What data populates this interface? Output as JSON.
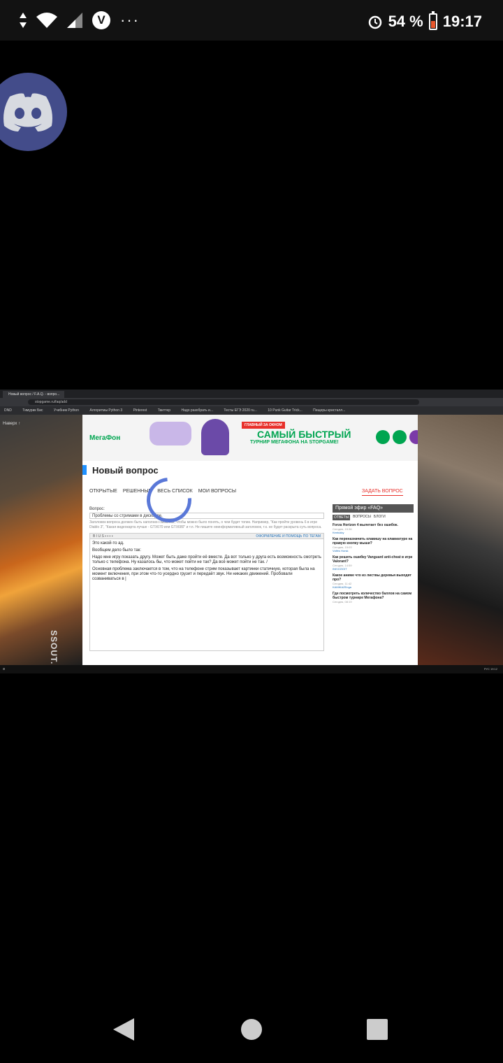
{
  "status_bar": {
    "battery_percent": "54 %",
    "time": "19:17",
    "vpn_letter": "V",
    "more": "···"
  },
  "video": {
    "browser": {
      "tab_title": "Новый вопрос / F.A.Q. - вопро...",
      "url": "stopgame.ru/faq/add",
      "bookmarks": [
        "DND",
        "Тимурик Бис",
        "Учебник Python",
        "Алгоритмы Python 3",
        "Pinterest",
        "Твиттер",
        "Надо разобрать и...",
        "Тесты ЕГЭ 2020 ru...",
        "10 Punk Guitar Trick...",
        "Пещеры кристалл..."
      ]
    },
    "left_bg_tag": "Наверх ↑",
    "watermark": "SSOUT.NET",
    "banner": {
      "brand": "МегаФон",
      "badge": "ГЛАВНЫЙ ЗА ОКНОМ",
      "title": "САМЫЙ БЫСТРЫЙ",
      "subtitle": "ТУРНИР МЕГАФОНА НА STOPGAME!"
    },
    "page_title": "Новый вопрос",
    "nav": [
      "ОТКРЫТЫЕ",
      "РЕШЕННЫЕ",
      "ВЕСЬ СПИСОК",
      "МОИ ВОПРОСЫ"
    ],
    "ask_button": "ЗАДАТЬ ВОПРОС",
    "form": {
      "label": "Вопрос:",
      "question": "Проблемы со стримами в дискорде.",
      "hint": "Заголовок вопроса должен быть наполнен смыслом, чтобы можно было понять, о чем будет топик. Например, \"Как пройти уровень 6 в игре Diablo 3\", \"Какая видеокарта лучше - GTX670 или GTX680\" и т.п. Не пишите неинформативный заголовок, т.к. не будет раскрыта суть вопроса.",
      "toolbar_link": "ОФОРМЛЕНИЕ И ПОМОЩЬ ПО ТЕГАМ",
      "editor_lines": [
        "Это какой-то ад.",
        "Вообщем дело было так:",
        "Надо мне игру показать другу. Может быть даже пройти её вместе. Да вот только у друга есть возможность смотреть только с телефона. Ну казалось бы, что может пойти не так? Да всё может пойти не так. /",
        "Основная проблема заключается в том, что на телефоне стрим показывает картинки статичную, которая была на момент включения, при этом что-то усердно грузит и передаёт звук. Ни никаких движений. Пробовали созваниваться в |"
      ]
    },
    "sidebar": {
      "header": "Прямой эфир «FAQ»",
      "tabs": [
        "ОТВЕТЫ",
        "ВОПРОСЫ",
        "БЛОГИ"
      ],
      "items": [
        {
          "title": "Forza Horizon 4 вылетает без ошибок.",
          "meta": "Сегодня, 15:36",
          "author": "Kentukky"
        },
        {
          "title": "Как переназначить клавишу на клавиатуре на правую кнопку мыши?",
          "meta": "Сегодня, 15:03",
          "author": "Volfes Horsk"
        },
        {
          "title": "Как решить ошибку Vanguard anti-cheat в игре Valorant?",
          "meta": "Сегодня, 14:59",
          "author": "INKVIZIOIT"
        },
        {
          "title": "Какое аниме что из листвы деревья выходят про?",
          "meta": "Сегодня, 11:42",
          "author": "KAMIKAZEnga"
        },
        {
          "title": "Где посмотреть количество баллов на самом быстром турнире Мегафона?",
          "meta": "Сегодня, 08:19",
          "author": ""
        }
      ]
    },
    "taskbar": {
      "lang": "РУС",
      "time": "19:12"
    }
  }
}
